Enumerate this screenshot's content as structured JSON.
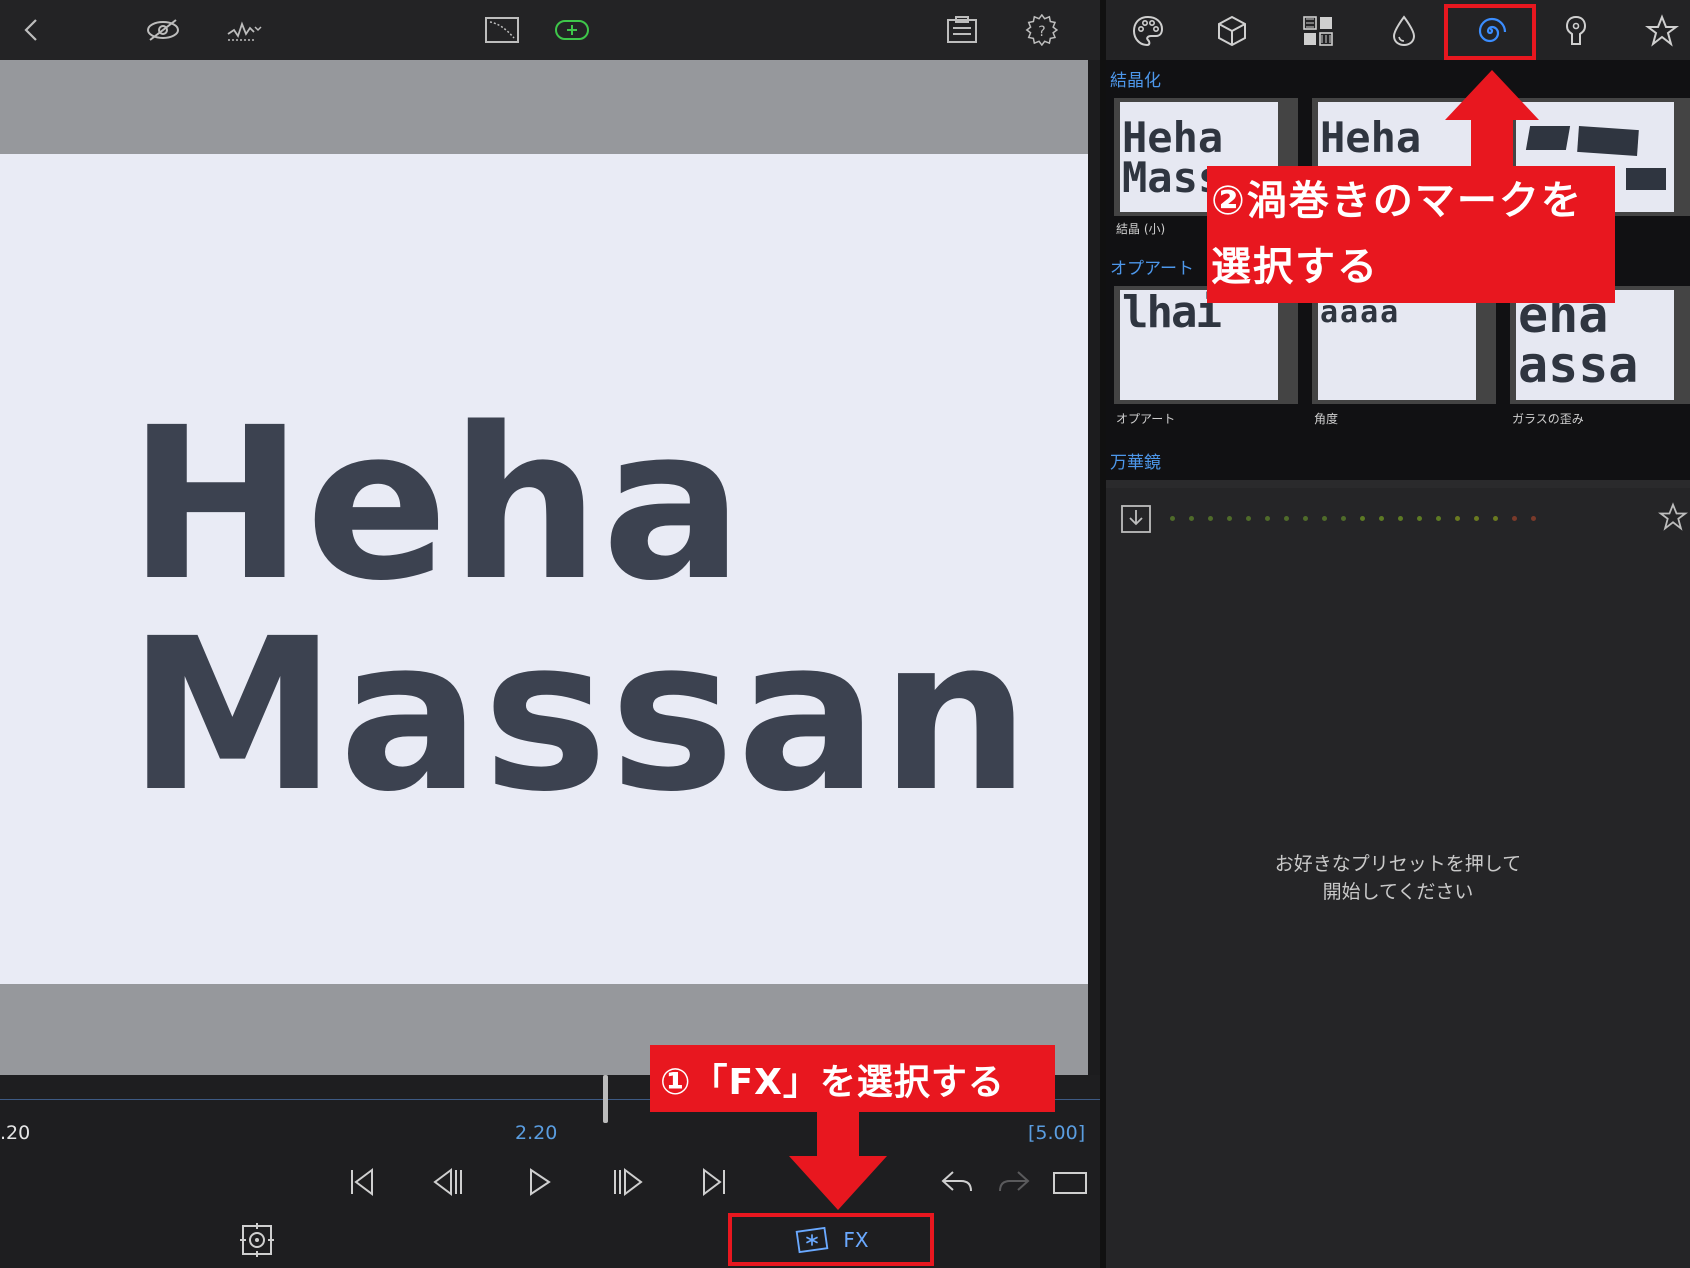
{
  "preview": {
    "title_line_1": "Heha",
    "title_line_2": "Massan"
  },
  "timeline": {
    "time_left": ".20",
    "time_current": "2.20",
    "time_total": "[5.00]"
  },
  "fx_button": {
    "label": "FX"
  },
  "right_toolbar": {
    "icons": [
      "palette-icon",
      "cube-icon",
      "pattern-grid-icon",
      "drop-icon",
      "spiral-icon",
      "keyhole-icon",
      "star-icon"
    ],
    "selected": "spiral-icon"
  },
  "presets": {
    "section_1": "結晶化",
    "section_2": "オプアート",
    "section_3": "万華鏡",
    "items": [
      {
        "caption": "結晶 (小)",
        "text": "Heha Mass"
      },
      {
        "caption": "",
        "text": "Heha"
      },
      {
        "caption": "",
        "text": ""
      },
      {
        "caption": "オプアート",
        "text": "lhai"
      },
      {
        "caption": "角度",
        "text": "aaaa"
      },
      {
        "caption": "ガラスの歪み",
        "text": "eha assa"
      }
    ]
  },
  "params": {
    "hint_line_1": "お好きなプリセットを押して",
    "hint_line_2": "開始してください"
  },
  "annotations": {
    "step1": "①「FX」を選択する",
    "step2_line_1": "②渦巻きのマークを",
    "step2_line_2": "選択する",
    "color": "#e8171f"
  },
  "colors": {
    "accent_blue": "#4d97ea",
    "add_button_green": "#3ec64a",
    "canvas_bg": "#e9ebf5",
    "text_dark": "#3c4250"
  }
}
